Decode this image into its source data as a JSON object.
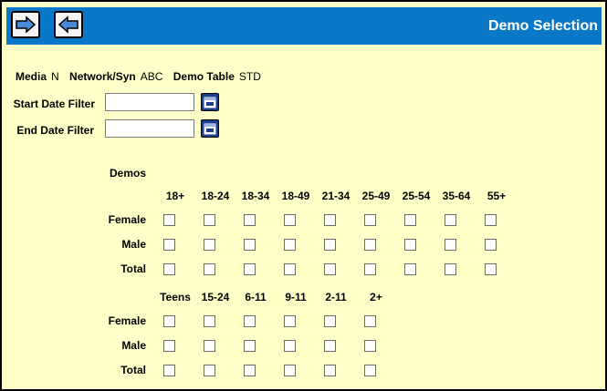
{
  "header": {
    "title": "Demo Selection",
    "forward_icon": "arrow-right-icon",
    "back_icon": "arrow-left-icon"
  },
  "info": {
    "media_label": "Media",
    "media_value": "N",
    "network_label": "Network/Syn",
    "network_value": "ABC",
    "demo_table_label": "Demo Table",
    "demo_table_value": "STD"
  },
  "filters": {
    "start_label": "Start Date Filter",
    "start_value": "",
    "end_label": "End Date Filter",
    "end_value": "",
    "calendar_icon": "calendar-icon"
  },
  "demos": {
    "title": "Demos",
    "adult_columns": [
      "18+",
      "18-24",
      "18-34",
      "18-49",
      "21-34",
      "25-49",
      "25-54",
      "35-64",
      "55+"
    ],
    "teen_columns": [
      "Teens",
      "15-24",
      "6-11",
      "9-11",
      "2-11",
      "2+"
    ],
    "rows": [
      "Female",
      "Male",
      "Total"
    ]
  },
  "colors": {
    "background": "#ffffc8",
    "header": "#0a78c8",
    "calendar_button": "#1c3d8c"
  }
}
